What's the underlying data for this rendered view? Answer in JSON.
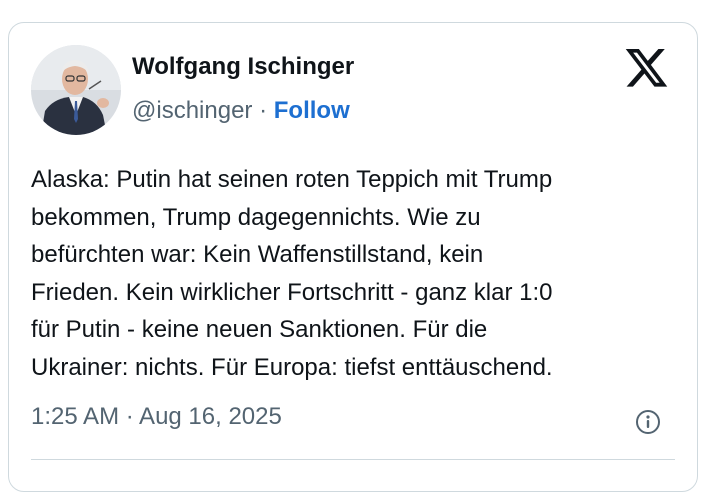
{
  "author": {
    "name": "Wolfgang Ischinger",
    "handle": "@ischinger",
    "separator": "·",
    "follow_label": "Follow"
  },
  "tweet": {
    "text": "Alaska: Putin hat seinen roten Teppich mit Trump\nbekommen, Trump dagegennichts. Wie zu\nbefürchten war: Kein Waffenstillstand, kein\nFrieden. Kein wirklicher Fortschritt - ganz klar 1:0\nfür Putin - keine neuen Sanktionen. Für die\nUkrainer: nichts. Für Europa: tiefst enttäuschend.",
    "timestamp": "1:25 AM · Aug 16, 2025"
  },
  "icons": {
    "platform_logo": "x-logo-icon",
    "info": "info-icon"
  },
  "colors": {
    "text": "#0f1419",
    "secondary": "#536471",
    "link": "#1d6fd1",
    "border": "#cfd9de"
  }
}
